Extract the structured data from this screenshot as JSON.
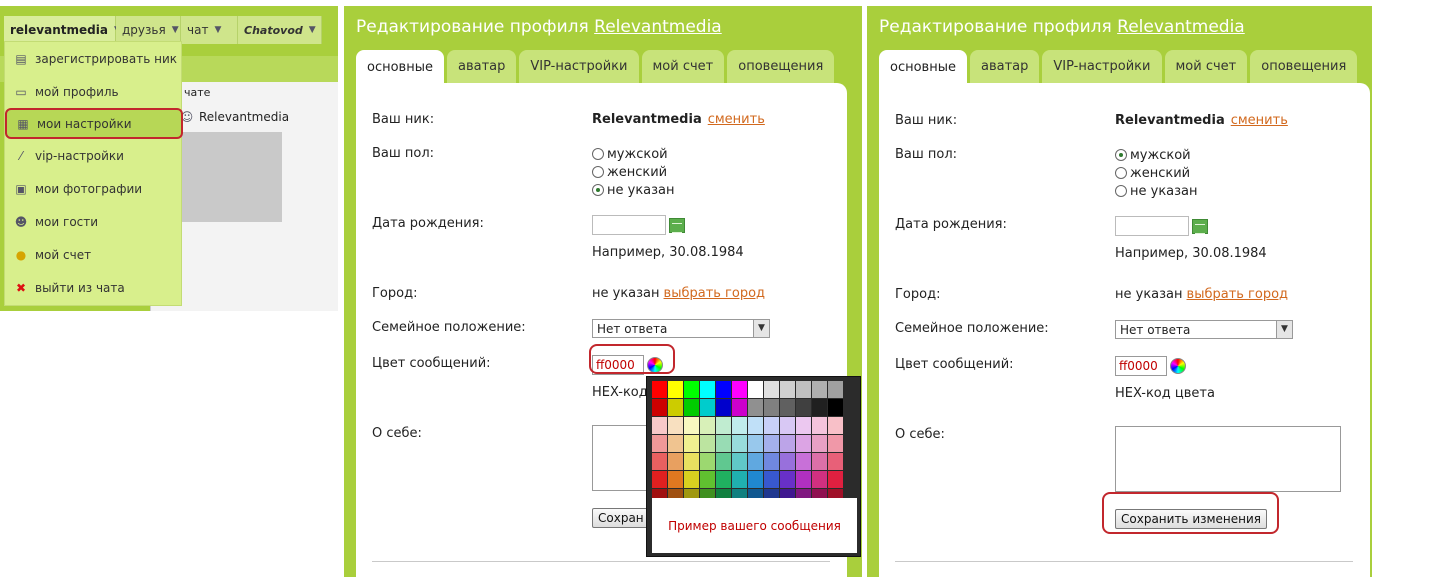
{
  "left_panel": {
    "topbar": [
      {
        "label": "relevantmedia"
      },
      {
        "label": "друзья"
      },
      {
        "label": "чат"
      },
      {
        "label": "Chatovod"
      }
    ],
    "menu": [
      {
        "label": "зарегистрировать ник",
        "icon": "register-icon"
      },
      {
        "label": "мой профиль",
        "icon": "profile-card-icon"
      },
      {
        "label": "мои настройки",
        "icon": "settings-icon",
        "highlighted": true
      },
      {
        "label": "vip-настройки",
        "icon": "wand-icon"
      },
      {
        "label": "мои фотографии",
        "icon": "photos-icon"
      },
      {
        "label": "мои гости",
        "icon": "guests-icon"
      },
      {
        "label": "мой счет",
        "icon": "coins-icon"
      },
      {
        "label": "выйти из чата",
        "icon": "close-icon"
      }
    ],
    "chat_label": "чате",
    "chat_user": "Relevantmedia"
  },
  "profile": {
    "title_prefix": "Редактирование профиля",
    "title_user": "Relevantmedia",
    "tabs": [
      "основные",
      "аватар",
      "VIP-настройки",
      "мой счет",
      "оповещения"
    ],
    "labels": {
      "nick": "Ваш ник:",
      "gender": "Ваш пол:",
      "birth": "Дата рождения:",
      "city": "Город:",
      "marital": "Семейное положение:",
      "color": "Цвет сообщений:",
      "about": "О себе:"
    },
    "nick_value": "Relevantmedia",
    "nick_change": "сменить",
    "gender_options": [
      "мужской",
      "женский",
      "не указан"
    ],
    "birth_example": "Например, 30.08.1984",
    "city_value": "не указан",
    "city_link": "выбрать город",
    "marital_value": "Нет ответа",
    "color_value": "ff0000",
    "color_hint": "HEX-код цвета",
    "color_hint_cropped": "HEX-код",
    "save_label": "Сохранить изменения",
    "save_label_cropped": "Сохран"
  },
  "mid_state": {
    "gender_selected": 2
  },
  "right_state": {
    "gender_selected": 0
  },
  "picker": {
    "preview_text": "Пример вашего сообщения",
    "colors": [
      "#ff0000",
      "#ffff00",
      "#00ff00",
      "#00ffff",
      "#0000ff",
      "#ff00ff",
      "#ffffff",
      "#e0e0e0",
      "#d0d0d0",
      "#c0c0c0",
      "#b0b0b0",
      "#a0a0a0",
      "#cc0000",
      "#cccc00",
      "#00cc00",
      "#00cccc",
      "#0000cc",
      "#cc00cc",
      "#909090",
      "#808080",
      "#606060",
      "#404040",
      "#202020",
      "#000000",
      "#f8c8c8",
      "#f8e0c0",
      "#f8f8c0",
      "#d8f0b8",
      "#c0ecd0",
      "#c0ecec",
      "#c0e0f8",
      "#c8d0f8",
      "#d8c8f4",
      "#ecc8f0",
      "#f4c4dc",
      "#f8c0c8",
      "#f09898",
      "#f0c490",
      "#f0f090",
      "#bce4a0",
      "#98dcb4",
      "#98dcdc",
      "#98c8ec",
      "#a4b0ec",
      "#bca4e8",
      "#dca4e4",
      "#e8a0c4",
      "#f098a8",
      "#e86060",
      "#e8a060",
      "#e8e060",
      "#9cd870",
      "#60c890",
      "#60c8c8",
      "#60a8e0",
      "#7088e0",
      "#9870dc",
      "#c870d8",
      "#dc70a8",
      "#e86078",
      "#e02020",
      "#e07820",
      "#d8d020",
      "#60c030",
      "#20b060",
      "#20b0b0",
      "#2088d0",
      "#3858d0",
      "#6830c8",
      "#b030c0",
      "#d03080",
      "#e02040",
      "#a01010",
      "#a05010",
      "#a09810",
      "#409020",
      "#108040",
      "#108080",
      "#105890",
      "#203890",
      "#401890",
      "#801880",
      "#901050",
      "#a01028",
      "#600808",
      "#603008",
      "#605808",
      "#285810",
      "#085028",
      "#085050",
      "#083858",
      "#102058",
      "#280858",
      "#500850",
      "#580830",
      "#600818"
    ]
  }
}
